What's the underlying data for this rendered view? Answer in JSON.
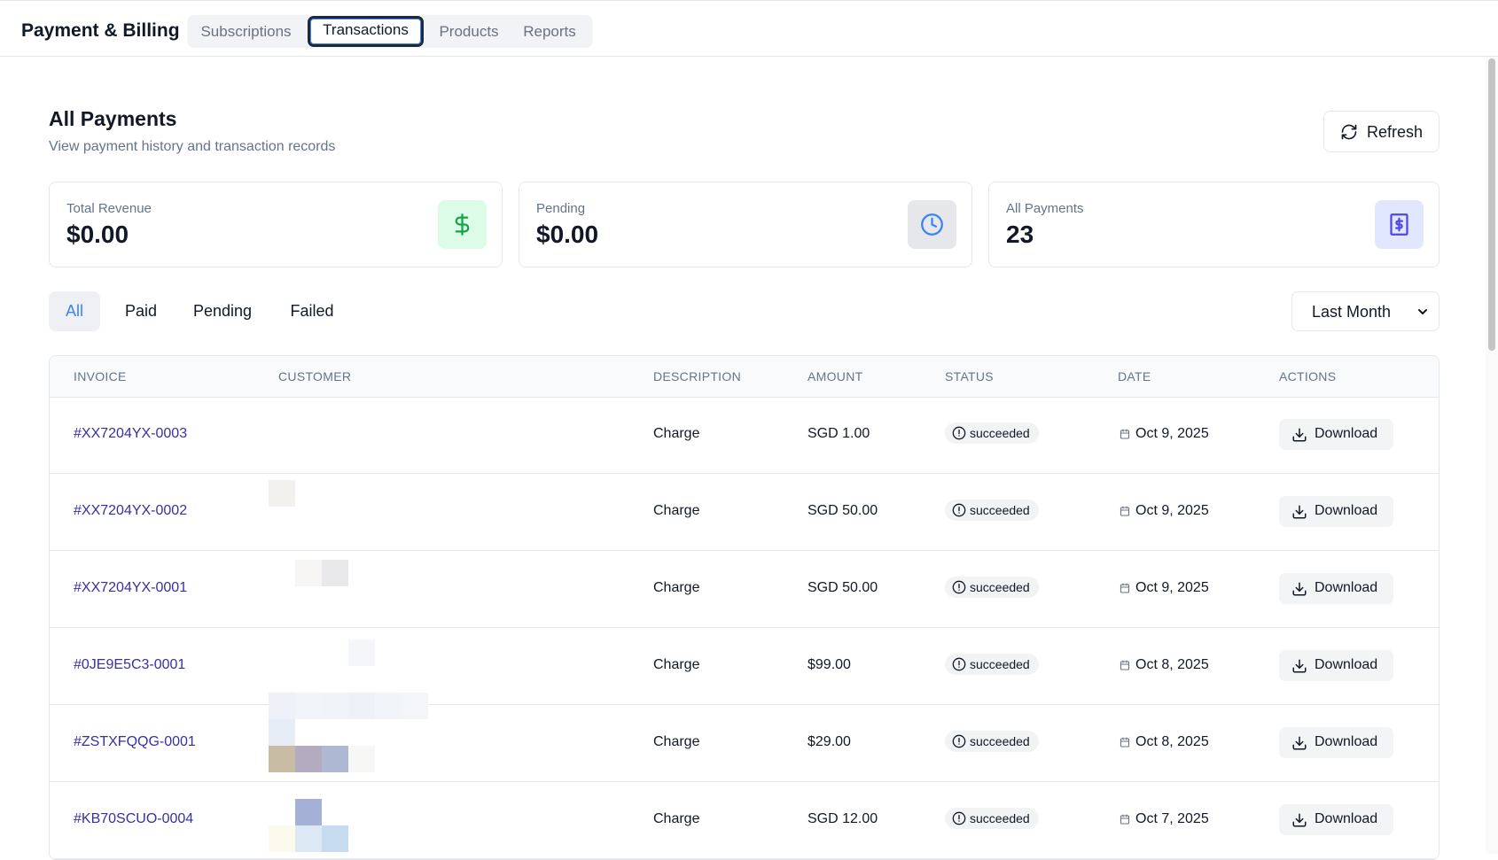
{
  "app": {
    "title": "Payment & Billing",
    "tabs": [
      {
        "label": "Subscriptions"
      },
      {
        "label": "Transactions"
      },
      {
        "label": "Products"
      },
      {
        "label": "Reports"
      }
    ]
  },
  "page": {
    "title": "All Payments",
    "subtitle": "View payment history and transaction records",
    "refresh_label": "Refresh"
  },
  "stats": [
    {
      "label": "Total Revenue",
      "value": "$0.00",
      "icon": "dollar-icon",
      "color": "#16a34a"
    },
    {
      "label": "Pending",
      "value": "$0.00",
      "icon": "clock-icon",
      "color": "#3b82f6"
    },
    {
      "label": "All Payments",
      "value": "23",
      "icon": "receipt-icon",
      "color": "#4f46e5"
    }
  ],
  "filters": [
    {
      "label": "All"
    },
    {
      "label": "Paid"
    },
    {
      "label": "Pending"
    },
    {
      "label": "Failed"
    }
  ],
  "range": {
    "selected": "Last Month"
  },
  "table": {
    "headers": [
      "INVOICE",
      "CUSTOMER",
      "DESCRIPTION",
      "AMOUNT",
      "STATUS",
      "DATE",
      "ACTIONS"
    ],
    "download_label": "Download",
    "rows": [
      {
        "invoice": "#XX7204YX-0003",
        "customer": "",
        "description": "Charge",
        "amount": "SGD 1.00",
        "status": "succeeded",
        "date": "Oct 9, 2025"
      },
      {
        "invoice": "#XX7204YX-0002",
        "customer": "",
        "description": "Charge",
        "amount": "SGD 50.00",
        "status": "succeeded",
        "date": "Oct 9, 2025"
      },
      {
        "invoice": "#XX7204YX-0001",
        "customer": "",
        "description": "Charge",
        "amount": "SGD 50.00",
        "status": "succeeded",
        "date": "Oct 9, 2025"
      },
      {
        "invoice": "#0JE9E5C3-0001",
        "customer": "",
        "description": "Charge",
        "amount": "$99.00",
        "status": "succeeded",
        "date": "Oct 8, 2025"
      },
      {
        "invoice": "#ZSTXFQQG-0001",
        "customer": "",
        "description": "Charge",
        "amount": "$29.00",
        "status": "succeeded",
        "date": "Oct 8, 2025"
      },
      {
        "invoice": "#KB70SCUO-0004",
        "customer": "",
        "description": "Charge",
        "amount": "SGD 12.00",
        "status": "succeeded",
        "date": "Oct 7, 2025"
      }
    ]
  },
  "colors": {
    "accent": "#3b82f6",
    "invoice_link": "#3730a3",
    "revenue_badge": "#dcfce7",
    "pending_badge": "#e5e7eb",
    "payments_badge": "#e0e7ff"
  }
}
